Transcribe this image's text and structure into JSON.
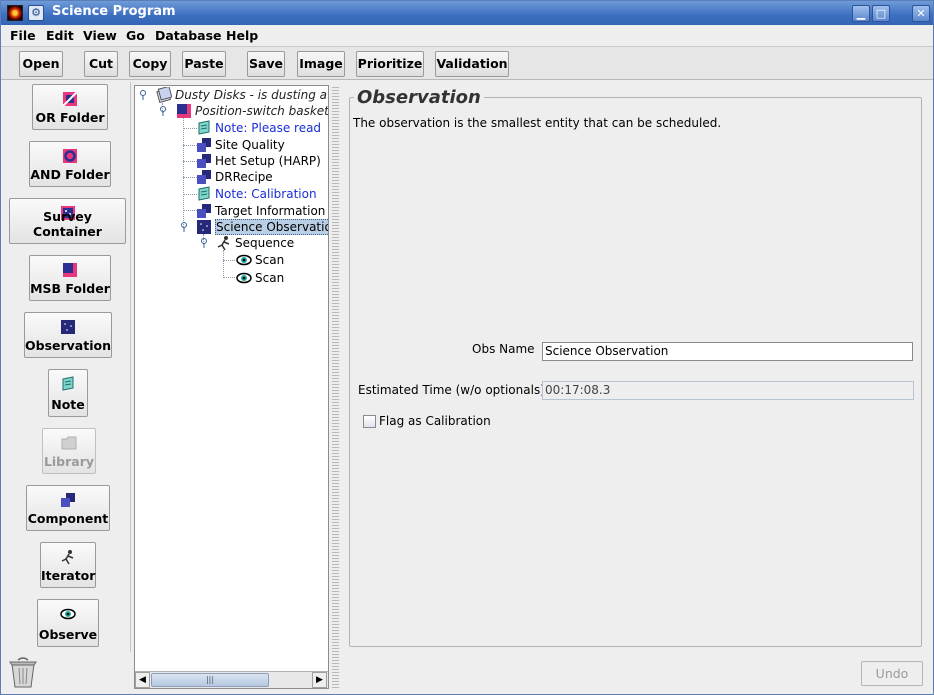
{
  "window": {
    "title": "Science Program"
  },
  "menubar": [
    "File",
    "Edit",
    "View",
    "Go",
    "Database",
    "Help"
  ],
  "toolbar": [
    "Open",
    "Cut",
    "Copy",
    "Paste",
    "Save",
    "Image",
    "Prioritize",
    "Validation"
  ],
  "palette": {
    "or_folder": "OR Folder",
    "and_folder": "AND Folder",
    "survey_container": "Survey Container",
    "msb_folder": "MSB Folder",
    "observation": "Observation",
    "note": "Note",
    "library": "Library",
    "component": "Component",
    "iterator": "Iterator",
    "observe": "Observe"
  },
  "tree": {
    "root": "Dusty Disks - is dusting a",
    "basket": "Position-switch basket",
    "note_please_read": "Note: Please read",
    "site_quality": "Site Quality",
    "het_setup": "Het Setup (HARP)",
    "drrecipe": "DRRecipe",
    "note_calibration": "Note: Calibration",
    "target_information": "Target Information",
    "science_observation": "Science Observation",
    "sequence": "Sequence",
    "scan1": "Scan",
    "scan2": "Scan"
  },
  "panel": {
    "title": "Observation",
    "description": "The observation is the smallest entity that can be scheduled.",
    "obs_name_label": "Obs Name",
    "obs_name_value": "Science Observation",
    "est_time_label": "Estimated Time (w/o optionals)",
    "est_time_value": "00:17:08.3",
    "flag_label": "Flag as Calibration",
    "flag_checked": false
  },
  "undo_label": "Undo"
}
